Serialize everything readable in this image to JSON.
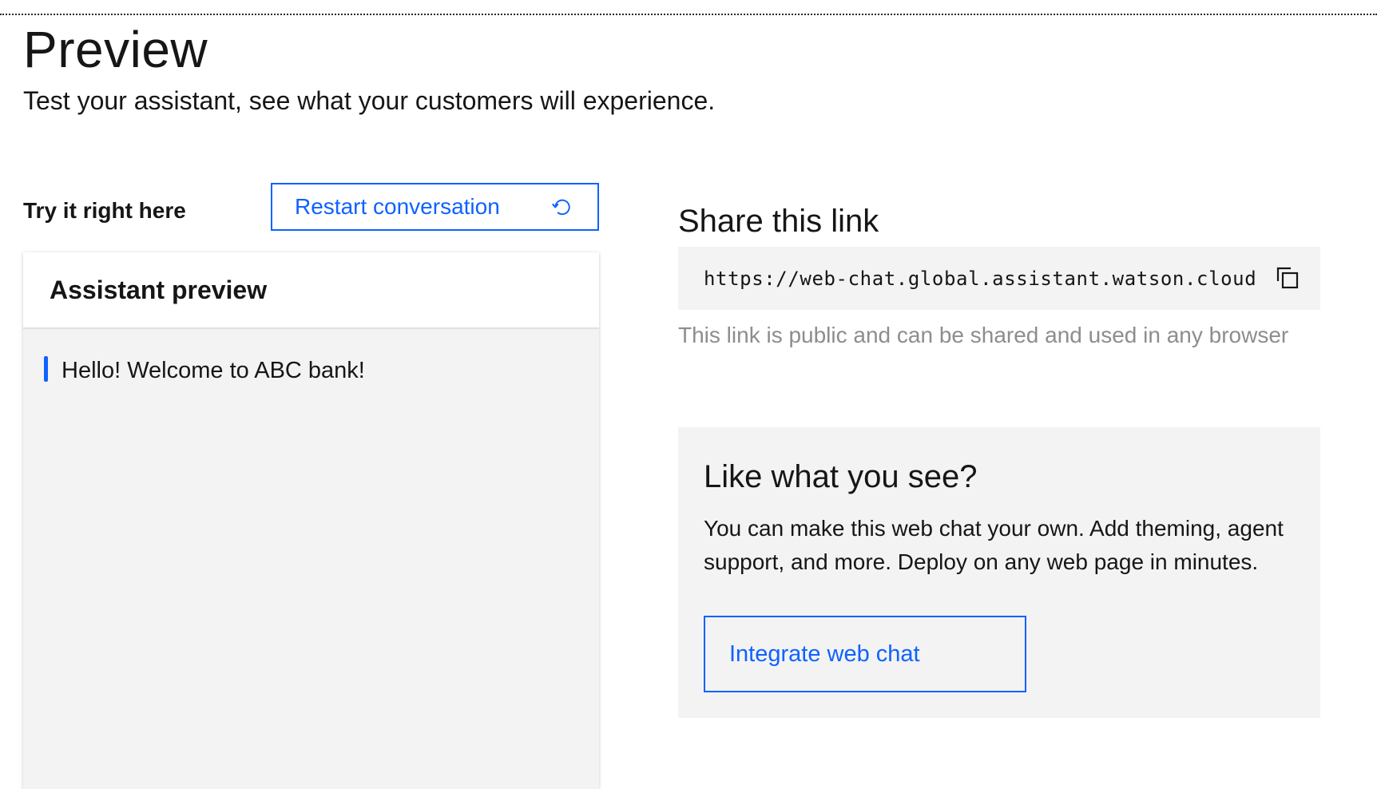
{
  "page": {
    "title": "Preview",
    "subtitle": "Test your assistant, see what your customers will experience."
  },
  "left": {
    "try_label": "Try it right here",
    "restart_button_label": "Restart conversation",
    "restart_icon": "restart-icon",
    "preview": {
      "title": "Assistant preview",
      "messages": [
        {
          "text": "Hello! Welcome to ABC bank!"
        }
      ]
    }
  },
  "share": {
    "title": "Share this link",
    "link": "https://web-chat.global.assistant.watson.cloud",
    "copy_icon": "copy-icon",
    "hint": "This link is public and can be shared and used in any browser"
  },
  "promo": {
    "title": "Like what you see?",
    "body": "You can make this web chat your own. Add theming, agent support, and more. Deploy on any web page in minutes.",
    "button_label": "Integrate web chat"
  },
  "colors": {
    "accent": "#0f62fe",
    "panel_bg": "#f3f3f3",
    "text": "#161616",
    "muted_text": "#8d8d8d"
  }
}
